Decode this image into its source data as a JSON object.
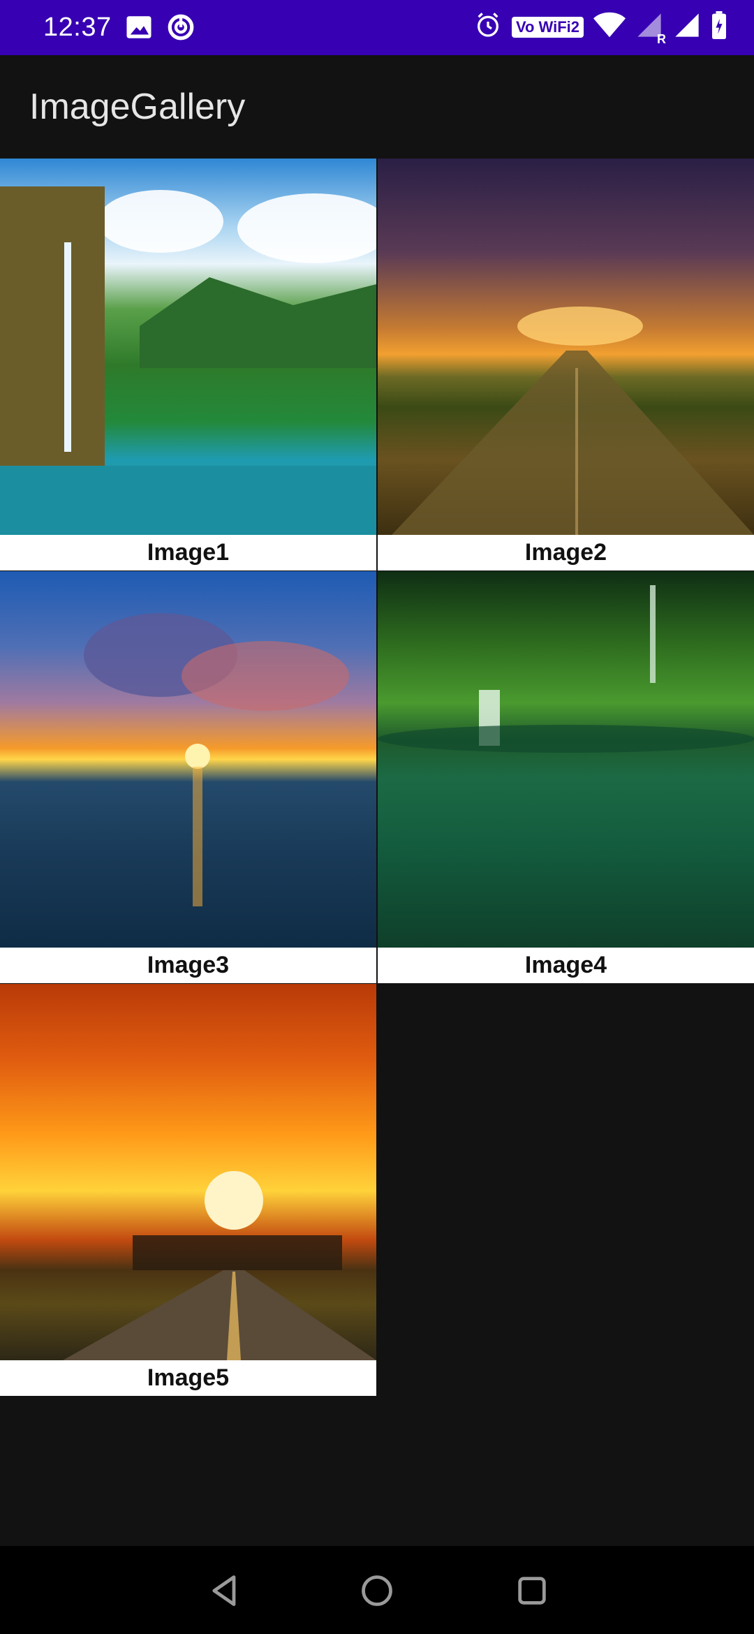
{
  "status_bar": {
    "time": "12:37",
    "background": "#3700B3",
    "left_icons": [
      "image-icon",
      "sync-icon"
    ],
    "right_icons": [
      "alarm-icon",
      "vowifi-badge",
      "wifi-icon",
      "signal-r-icon",
      "signal-icon",
      "battery-icon"
    ],
    "vowifi_label": "Vo WiFi2",
    "roaming_label": "R"
  },
  "app_bar": {
    "title": "ImageGallery"
  },
  "gallery": {
    "items": [
      {
        "caption": "Image1",
        "picture": "waterfall-lagoon"
      },
      {
        "caption": "Image2",
        "picture": "road-sunset-clouds"
      },
      {
        "caption": "Image3",
        "picture": "ocean-sunset"
      },
      {
        "caption": "Image4",
        "picture": "green-waterfall-pool"
      },
      {
        "caption": "Image5",
        "picture": "orange-sunset-road"
      }
    ]
  },
  "nav_bar": {
    "buttons": [
      "back-icon",
      "home-icon",
      "recents-icon"
    ]
  }
}
